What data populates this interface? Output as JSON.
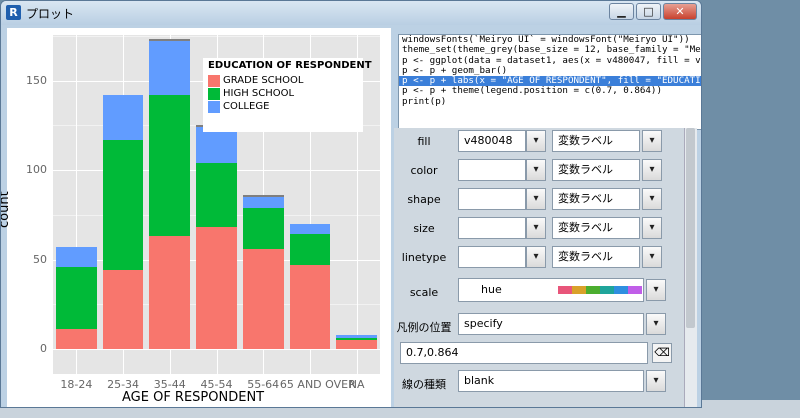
{
  "window": {
    "title": "プロット",
    "app_icon": "R"
  },
  "chart_data": {
    "type": "bar",
    "stacked": true,
    "categories": [
      "18-24",
      "25-34",
      "35-44",
      "45-54",
      "55-64",
      "65 AND OVER",
      "NA"
    ],
    "series": [
      {
        "name": "GRADE SCHOOL",
        "color": "#f8766d",
        "values": [
          11,
          44,
          63,
          68,
          56,
          47,
          5
        ]
      },
      {
        "name": "HIGH SCHOOL",
        "color": "#00ba38",
        "values": [
          35,
          73,
          79,
          36,
          23,
          17,
          1
        ]
      },
      {
        "name": "COLLEGE",
        "color": "#619cff",
        "values": [
          11,
          25,
          30,
          20,
          6,
          6,
          2
        ]
      },
      {
        "name": "",
        "color": "#7f7f7f",
        "values": [
          0,
          0,
          1,
          1,
          1,
          0,
          0
        ]
      }
    ],
    "ylim": [
      0,
      190
    ],
    "yticks": [
      0,
      50,
      100,
      150
    ],
    "xlabel": "AGE OF RESPONDENT",
    "ylabel": "count",
    "legend": {
      "title": "EDUCATION OF RESPONDENT",
      "position": "top-right"
    }
  },
  "code": [
    "windowsFonts(`Meiryo UI` = windowsFont(\"Meiryo UI\"))",
    "theme_set(theme_grey(base_size = 12, base_family = \"Meiryo UI\"))",
    "p <- ggplot(data = dataset1, aes(x = v480047, fill = v480048))",
    "p <- p + geom_bar()",
    "p <- p + labs(x = \"AGE OF RESPONDENT\", fill = \"EDUCATION OF RESPONDENT\")",
    "p <- p + theme(legend.position = c(0.7, 0.864))",
    "print(p)"
  ],
  "code_selected_line": 4,
  "controls": {
    "fill": {
      "label": "fill",
      "value": "v480048",
      "type": "変数ラベル"
    },
    "color": {
      "label": "color",
      "value": "",
      "type": "変数ラベル"
    },
    "shape": {
      "label": "shape",
      "value": "",
      "type": "変数ラベル"
    },
    "size": {
      "label": "size",
      "value": "",
      "type": "変数ラベル"
    },
    "linetype": {
      "label": "linetype",
      "value": "",
      "type": "変数ラベル"
    },
    "scale": {
      "label": "scale",
      "value": "hue"
    },
    "legend_pos": {
      "label": "凡例の位置",
      "value": "specify"
    },
    "legend_coords": {
      "value": "0.7,0.864"
    },
    "line_type": {
      "label": "線の種類",
      "value": "blank"
    }
  },
  "palette": [
    "#e8557a",
    "#d9a12a",
    "#4cae2f",
    "#1fa59b",
    "#2f8fe0",
    "#c05ee8"
  ]
}
